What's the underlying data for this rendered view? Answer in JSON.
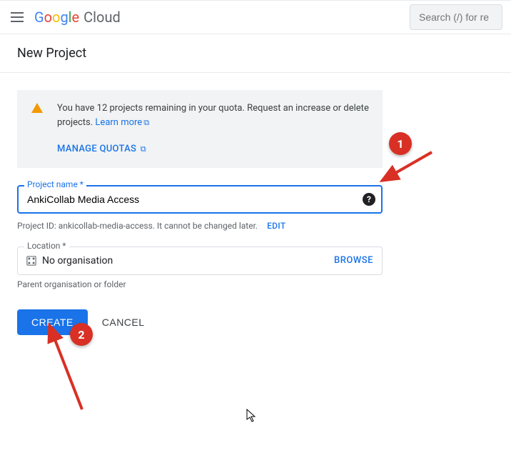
{
  "header": {
    "logo_google": "Google",
    "logo_cloud": "Cloud",
    "search_placeholder": "Search (/) for re"
  },
  "page": {
    "title": "New Project"
  },
  "notice": {
    "text_part1": "You have 12 projects remaining in your quota. Request an increase or delete projects. ",
    "learn_more": "Learn more",
    "manage_quotas": "MANAGE QUOTAS"
  },
  "project_name": {
    "label": "Project name *",
    "value": "AnkiCollab Media Access"
  },
  "project_id": {
    "prefix": "Project ID: ankicollab-media-access. It cannot be changed later.",
    "edit": "EDIT"
  },
  "location": {
    "label": "Location *",
    "value": "No organisation",
    "browse": "BROWSE",
    "helper": "Parent organisation or folder"
  },
  "buttons": {
    "create": "CREATE",
    "cancel": "CANCEL"
  },
  "annotations": {
    "one": "1",
    "two": "2"
  }
}
